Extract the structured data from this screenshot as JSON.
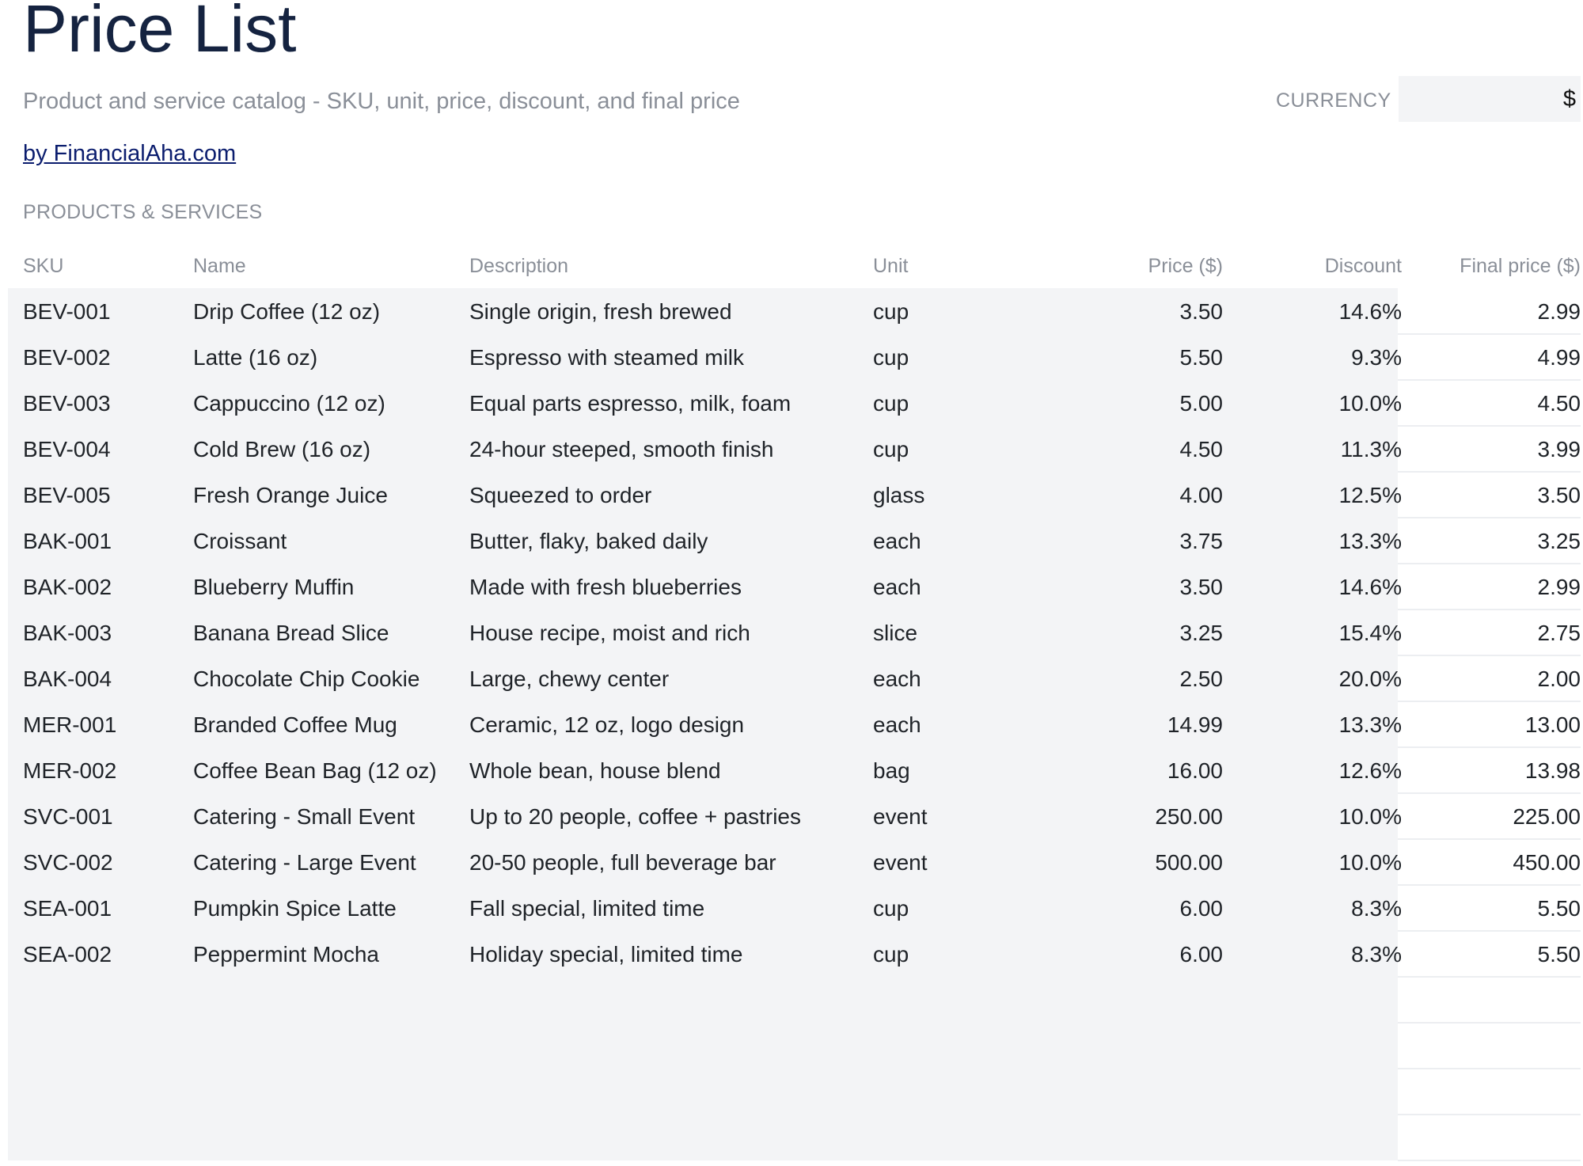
{
  "header": {
    "title": "Price List",
    "subtitle": "Product and service catalog - SKU, unit, price, discount, and final price",
    "author_link": "by FinancialAha.com",
    "currency_label": "CURRENCY",
    "currency_value": "$"
  },
  "section": {
    "label": "PRODUCTS & SERVICES"
  },
  "table": {
    "columns": {
      "sku": "SKU",
      "name": "Name",
      "description": "Description",
      "unit": "Unit",
      "price": "Price ($)",
      "discount": "Discount",
      "final_price": "Final price ($)"
    },
    "rows": [
      {
        "sku": "BEV-001",
        "name": "Drip Coffee (12 oz)",
        "description": "Single origin, fresh brewed",
        "unit": "cup",
        "price": "3.50",
        "discount": "14.6%",
        "final_price": "2.99"
      },
      {
        "sku": "BEV-002",
        "name": "Latte (16 oz)",
        "description": "Espresso with steamed milk",
        "unit": "cup",
        "price": "5.50",
        "discount": "9.3%",
        "final_price": "4.99"
      },
      {
        "sku": "BEV-003",
        "name": "Cappuccino (12 oz)",
        "description": "Equal parts espresso, milk, foam",
        "unit": "cup",
        "price": "5.00",
        "discount": "10.0%",
        "final_price": "4.50"
      },
      {
        "sku": "BEV-004",
        "name": "Cold Brew (16 oz)",
        "description": "24-hour steeped, smooth finish",
        "unit": "cup",
        "price": "4.50",
        "discount": "11.3%",
        "final_price": "3.99"
      },
      {
        "sku": "BEV-005",
        "name": "Fresh Orange Juice",
        "description": "Squeezed to order",
        "unit": "glass",
        "price": "4.00",
        "discount": "12.5%",
        "final_price": "3.50"
      },
      {
        "sku": "BAK-001",
        "name": "Croissant",
        "description": "Butter, flaky, baked daily",
        "unit": "each",
        "price": "3.75",
        "discount": "13.3%",
        "final_price": "3.25"
      },
      {
        "sku": "BAK-002",
        "name": "Blueberry Muffin",
        "description": "Made with fresh blueberries",
        "unit": "each",
        "price": "3.50",
        "discount": "14.6%",
        "final_price": "2.99"
      },
      {
        "sku": "BAK-003",
        "name": "Banana Bread Slice",
        "description": "House recipe, moist and rich",
        "unit": "slice",
        "price": "3.25",
        "discount": "15.4%",
        "final_price": "2.75"
      },
      {
        "sku": "BAK-004",
        "name": "Chocolate Chip Cookie",
        "description": "Large, chewy center",
        "unit": "each",
        "price": "2.50",
        "discount": "20.0%",
        "final_price": "2.00"
      },
      {
        "sku": "MER-001",
        "name": "Branded Coffee Mug",
        "description": "Ceramic, 12 oz, logo design",
        "unit": "each",
        "price": "14.99",
        "discount": "13.3%",
        "final_price": "13.00"
      },
      {
        "sku": "MER-002",
        "name": "Coffee Bean Bag (12 oz)",
        "description": "Whole bean, house blend",
        "unit": "bag",
        "price": "16.00",
        "discount": "12.6%",
        "final_price": "13.98"
      },
      {
        "sku": "SVC-001",
        "name": "Catering - Small Event",
        "description": "Up to 20 people, coffee + pastries",
        "unit": "event",
        "price": "250.00",
        "discount": "10.0%",
        "final_price": "225.00"
      },
      {
        "sku": "SVC-002",
        "name": "Catering - Large Event",
        "description": "20-50 people, full beverage bar",
        "unit": "event",
        "price": "500.00",
        "discount": "10.0%",
        "final_price": "450.00"
      },
      {
        "sku": "SEA-001",
        "name": "Pumpkin Spice Latte",
        "description": "Fall special, limited time",
        "unit": "cup",
        "price": "6.00",
        "discount": "8.3%",
        "final_price": "5.50"
      },
      {
        "sku": "SEA-002",
        "name": "Peppermint Mocha",
        "description": "Holiday special, limited time",
        "unit": "cup",
        "price": "6.00",
        "discount": "8.3%",
        "final_price": "5.50"
      }
    ],
    "empty_rows": 4
  }
}
